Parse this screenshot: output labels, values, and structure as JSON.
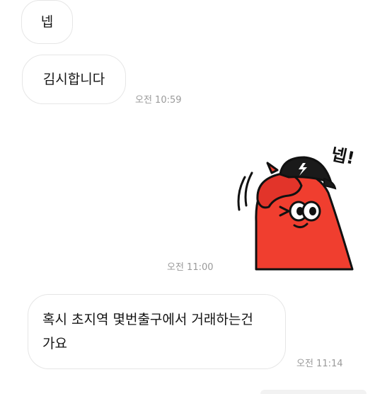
{
  "messages": [
    {
      "text": "넵"
    },
    {
      "text": "김시합니다",
      "time": "오전 10:59"
    },
    {
      "sticker": "red-character-saluting-sticker",
      "sticker_text": "넵!",
      "time": "오전 11:00"
    },
    {
      "text_line1": "혹시 초지역 몇번출구에서 거래하는건",
      "text_line2": "가요",
      "time": "오전 11:14"
    }
  ],
  "colors": {
    "sticker_red": "#f03e2f",
    "bubble_border": "#e6e6e6",
    "timestamp": "#9a9a9a"
  }
}
